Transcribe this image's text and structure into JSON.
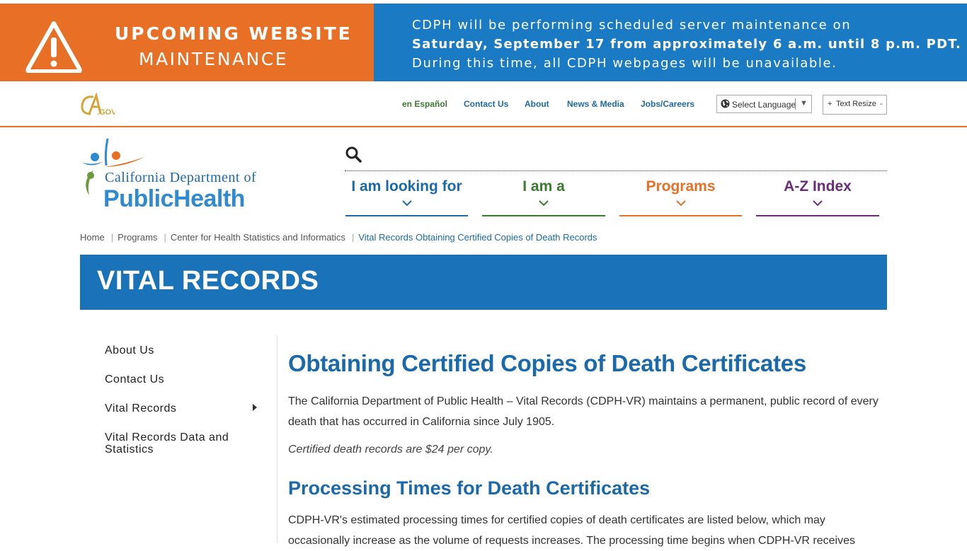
{
  "banner": {
    "title": "UPCOMING WEBSITE",
    "subtitle": "MAINTENANCE",
    "line1": "CDPH will be performing scheduled server maintenance on",
    "line2": "Saturday, September 17 from approximately 6 a.m. until 8 p.m. PDT.",
    "line3": "During this time, all CDPH webpages will be unavailable.",
    "left_color": "#e87026",
    "right_color": "#1a7bc4"
  },
  "utility": {
    "cagov_logo": "CA.GOV",
    "links": [
      "en Español",
      "Contact Us",
      "About",
      "News & Media",
      "Jobs/Careers"
    ],
    "select_language": "Select Language",
    "text_resize": "Text Resize",
    "plus": "+",
    "minus": "-"
  },
  "logo": {
    "line1": "California Department of",
    "line2": "PublicHealth"
  },
  "nav": {
    "items": [
      {
        "label": "I am looking for",
        "color": "#1a6aab"
      },
      {
        "label": "I am a",
        "color": "#3a7b2e"
      },
      {
        "label": "Programs",
        "color": "#e87026"
      },
      {
        "label": "A-Z Index",
        "color": "#6b2c7a"
      }
    ]
  },
  "breadcrumb": {
    "items": [
      "Home",
      "Programs",
      "Center for Health Statistics and Informatics"
    ],
    "current": "Vital Records Obtaining Certified Copies of Death Records"
  },
  "page": {
    "title": "VITAL RECORDS"
  },
  "sidebar": {
    "items": [
      "About Us",
      "Contact Us",
      "Vital Records",
      "Vital Records Data and Statistics"
    ]
  },
  "content": {
    "h1": "Obtaining Certified Copies of Death Certificates",
    "p1": "The California Department of Public Health – Vital Records (CDPH-VR) maintains a permanent, public record of every death that has occurred in California since July 1905.",
    "p2": "Certified death records are $24 per copy.",
    "h2": "Processing Times for Death Certificates",
    "p3": "CDPH-VR's estimated processing times for certified copies of death certificates are listed below, which may occasionally increase as the volume of requests increases. The processing time begins when CDPH-VR receives"
  }
}
